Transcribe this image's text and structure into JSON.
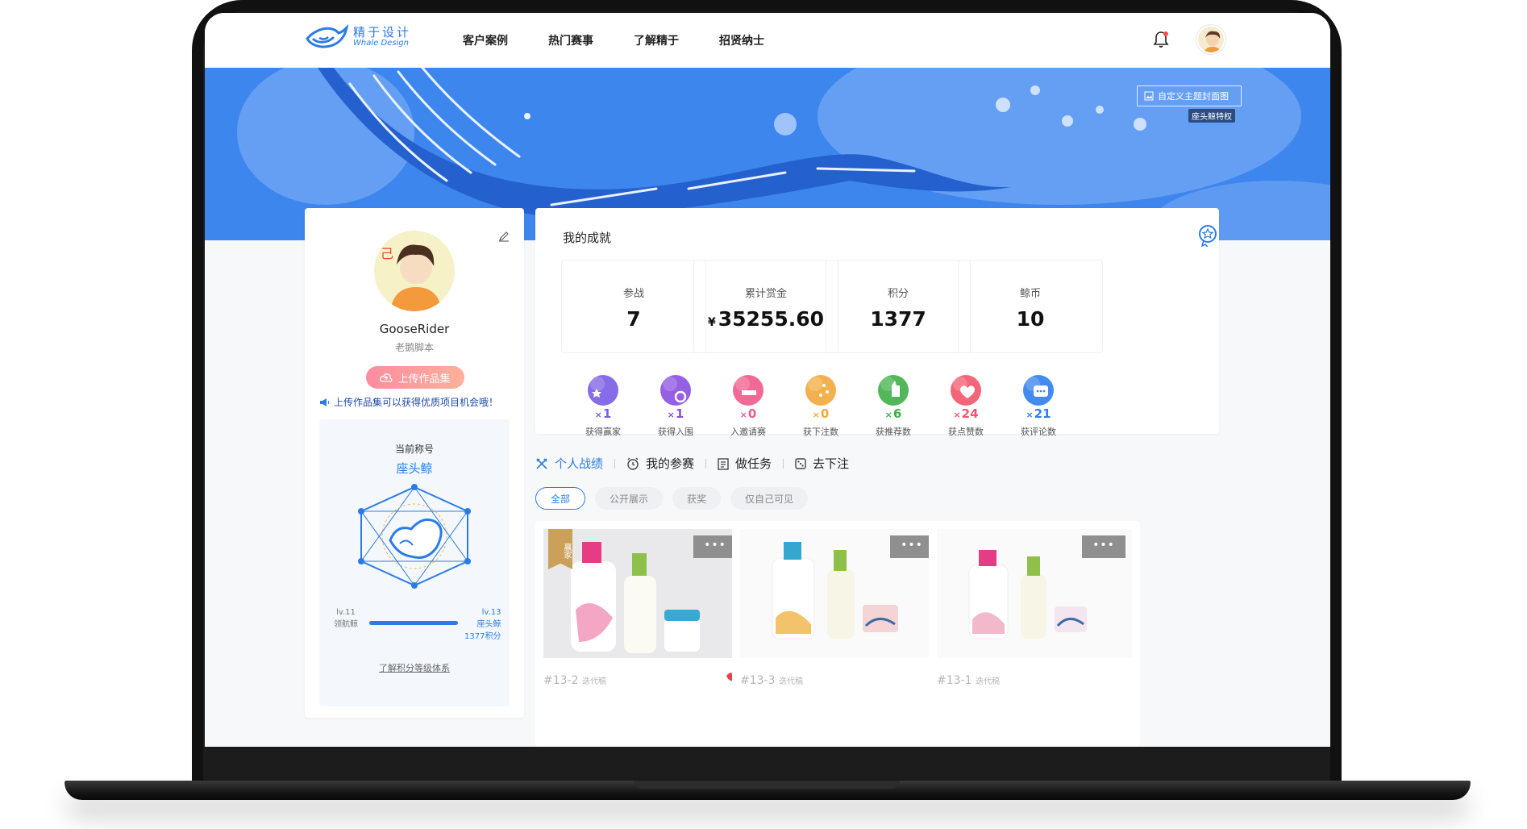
{
  "nav": {
    "logo_cn": "精于设计",
    "logo_en": "Whale Design",
    "links": [
      "客户案例",
      "热门赛事",
      "了解精于",
      "招贤纳士"
    ]
  },
  "banner": {
    "custom_cover": "自定义主题封面图",
    "privilege": "座头鲸特权"
  },
  "profile": {
    "username": "GooseRider",
    "subname": "老鹅脚本",
    "upload_button": "上传作品集",
    "upload_tip": "上传作品集可以获得优质项目机会哦！",
    "rank_label": "当前称号",
    "rank_name": "座头鲸",
    "level_from": {
      "level": "lv.11",
      "name": "领航鲸"
    },
    "level_to": {
      "level": "lv.13",
      "name": "座头鲸",
      "points": "1377积分"
    },
    "level_progress": 1.0,
    "rank_link": "了解积分等级体系"
  },
  "achievements": {
    "title": "我的成就",
    "stats": [
      {
        "label": "参战",
        "value": "7",
        "prefix": ""
      },
      {
        "label": "累计赏金",
        "value": "35255.60",
        "prefix": "¥"
      },
      {
        "label": "积分",
        "value": "1377",
        "prefix": ""
      },
      {
        "label": "鲸币",
        "value": "10",
        "prefix": ""
      }
    ],
    "medals": [
      {
        "label": "获得赢家",
        "count": "1",
        "color": "#7a5ce6"
      },
      {
        "label": "获得入围",
        "count": "1",
        "color": "#8a4fe0"
      },
      {
        "label": "入邀请赛",
        "count": "0",
        "color": "#ef5a8a"
      },
      {
        "label": "获下注数",
        "count": "0",
        "color": "#f2a93b"
      },
      {
        "label": "获推荐数",
        "count": "6",
        "color": "#3fae49"
      },
      {
        "label": "获点赞数",
        "count": "24",
        "color": "#f2556a"
      },
      {
        "label": "获评论数",
        "count": "21",
        "color": "#2f7df0"
      }
    ]
  },
  "tabs": [
    "个人战绩",
    "我的参赛",
    "做任务",
    "去下注"
  ],
  "filters": [
    "全部",
    "公开展示",
    "获奖",
    "仅自己可见"
  ],
  "works": [
    {
      "id": "#13-2",
      "tag": "迭代稿",
      "badge": "赢家",
      "more": "•••"
    },
    {
      "id": "#13-3",
      "tag": "迭代稿",
      "more": "•••"
    },
    {
      "id": "#13-1",
      "tag": "迭代稿",
      "more": "•••"
    }
  ],
  "colors": {
    "accent": "#2b7be7",
    "banner": "#3d86ee"
  }
}
